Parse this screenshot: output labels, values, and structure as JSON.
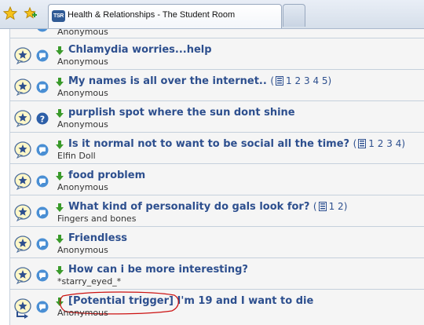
{
  "browser": {
    "tab_title": "Health & Relationships - The Student Room",
    "logo_text": "TSR"
  },
  "threads": [
    {
      "title": "",
      "author": "Anonymous",
      "pages": []
    },
    {
      "title": "Chlamydia worries...help",
      "author": "Anonymous",
      "pages": [],
      "type": "discussion"
    },
    {
      "title": "My names is all over the internet..",
      "author": "Anonymous",
      "pages": [
        "1",
        "2",
        "3",
        "4",
        "5"
      ],
      "type": "discussion"
    },
    {
      "title": "purplish spot where the sun dont shine",
      "author": "Anonymous",
      "pages": [],
      "type": "question"
    },
    {
      "title": "Is it normal not to want to be social all the time?",
      "author": "Elfin Doll",
      "pages": [
        "1",
        "2",
        "3",
        "4"
      ],
      "type": "discussion"
    },
    {
      "title": "food problem",
      "author": "Anonymous",
      "pages": [],
      "type": "discussion"
    },
    {
      "title": "What kind of personality do gals look for?",
      "author": "Fingers and bones",
      "pages": [
        "1",
        "2"
      ],
      "type": "discussion"
    },
    {
      "title": "Friendless",
      "author": "Anonymous",
      "pages": [],
      "type": "discussion"
    },
    {
      "title": "How can i be more interesting?",
      "author": "*starry_eyed_*",
      "pages": [],
      "type": "discussion"
    },
    {
      "title": "I'm 19 and I want to die",
      "prefix": "[Potential trigger]",
      "author": "Anonymous",
      "pages": [],
      "type": "discussion"
    }
  ],
  "colors": {
    "link": "#2d4f8e",
    "highlight_circle": "#cc1111",
    "row_bg": "#f5f5f5"
  }
}
